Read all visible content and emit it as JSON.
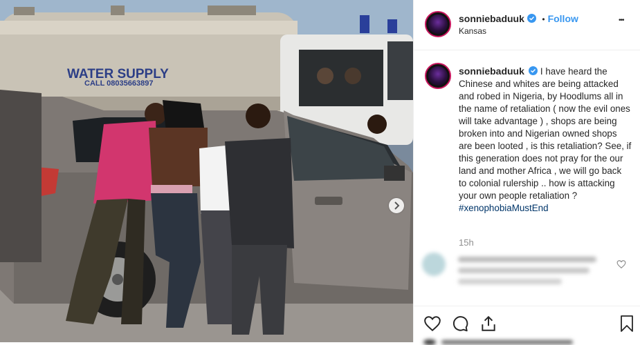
{
  "photo": {
    "truck_text": "WATER SUPPLY",
    "truck_phone": "CALL 08035663897"
  },
  "post": {
    "username": "sonniebaduuk",
    "separator": "•",
    "follow_label": "Follow",
    "location": "Kansas",
    "more_label": "•••",
    "caption_text": "I have heard the Chinese and whites are being attacked and robed in Nigeria, by Hoodlums all in the name of retaliation ( now the evil ones will take advantage ) , shops are being broken into and Nigerian owned shops are been looted , is this retaliation? See, if this generation does not pray for the our land and mother Africa , we will go back to colonial rulership .. how is attacking your own people retaliation ?",
    "hashtag": "#xenophobiaMustEnd",
    "time_ago": "15h"
  },
  "icons": {
    "next": "chevron-right-icon",
    "like": "heart-icon",
    "comment": "comment-icon",
    "share": "share-icon",
    "save": "bookmark-icon"
  }
}
